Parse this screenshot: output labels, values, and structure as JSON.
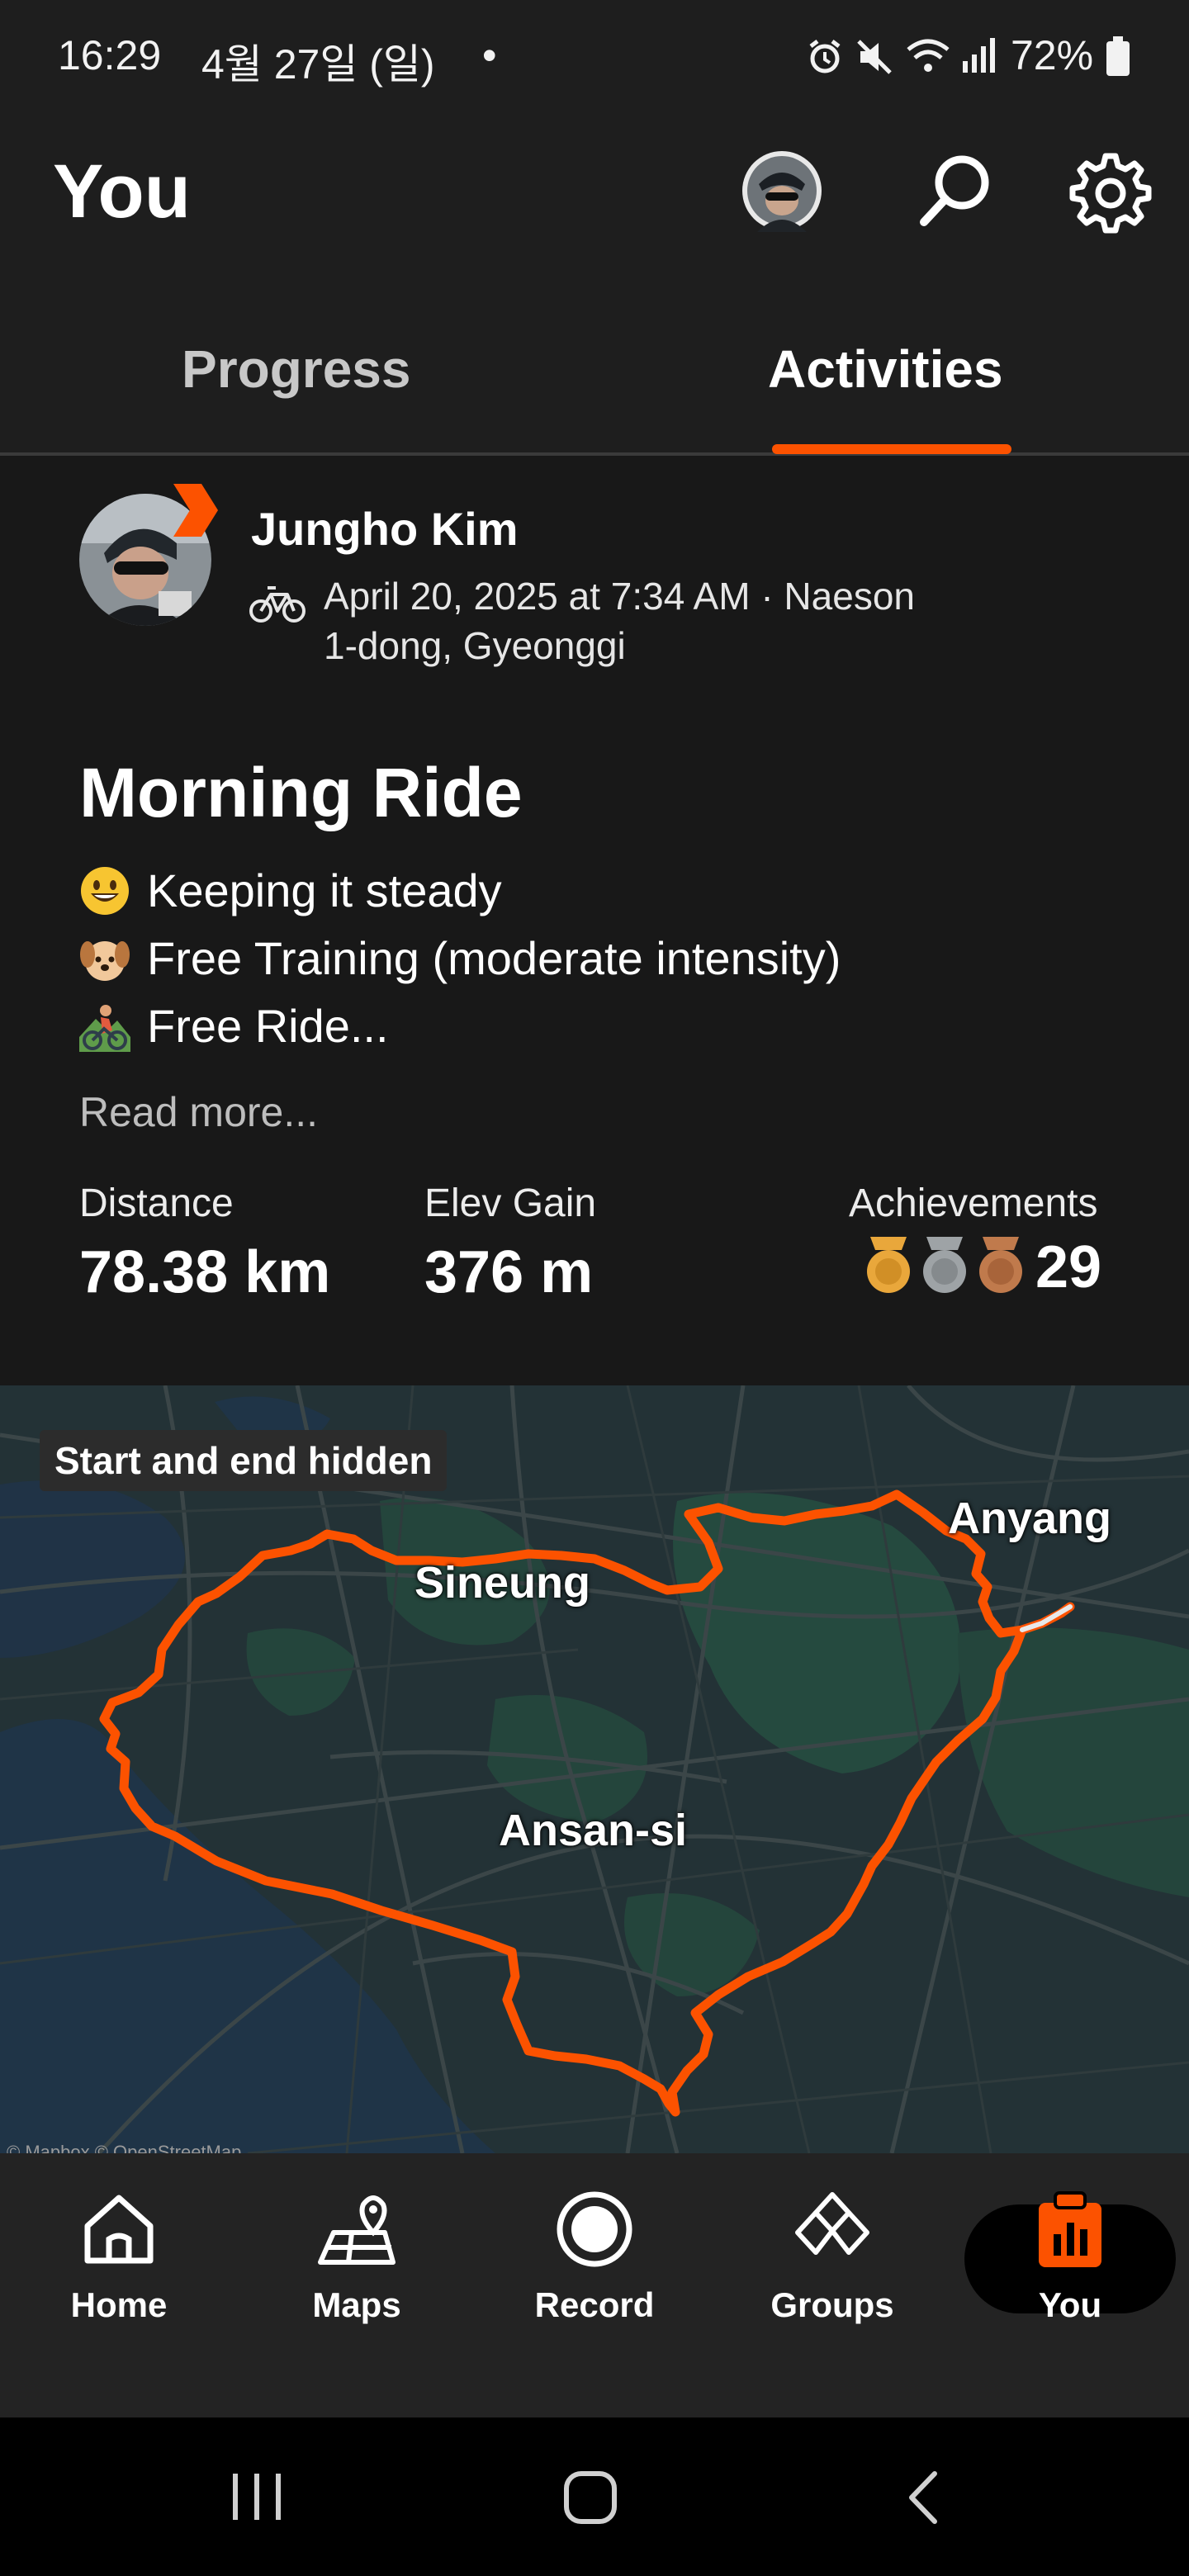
{
  "status_bar": {
    "time": "16:29",
    "date": "4월 27일 (일)",
    "dot": "•",
    "battery": "72%",
    "icons": [
      "alarm-icon",
      "mute-icon",
      "wifi-icon",
      "signal-icon",
      "battery-icon"
    ]
  },
  "header": {
    "title": "You",
    "icons": [
      "avatar",
      "search-icon",
      "gear-icon"
    ]
  },
  "tabs": [
    {
      "label": "Progress",
      "active": false
    },
    {
      "label": "Activities",
      "active": true
    }
  ],
  "activity": {
    "athlete": "Jungho Kim",
    "meta_line1": "April 20, 2025 at 7:34 AM · Naeson",
    "meta_line2": "1-dong, Gyeonggi",
    "title": "Morning Ride",
    "description": [
      {
        "icon": "smiley-emoji",
        "text": "Keeping it steady"
      },
      {
        "icon": "dog-emoji",
        "text": "Free Training (moderate intensity)"
      },
      {
        "icon": "cyclist-emoji",
        "text": "Free Ride..."
      }
    ],
    "read_more": "Read more...",
    "stats": {
      "distance_label": "Distance",
      "distance_value": "78.38 km",
      "elev_label": "Elev Gain",
      "elev_value": "376 m",
      "achievements_label": "Achievements",
      "achievements_count": "29"
    }
  },
  "map": {
    "chip": "Start and end hidden",
    "labels": [
      "Anyang",
      "Sineung",
      "Ansan-si"
    ],
    "attribution": "© Mapbox © OpenStreetMap",
    "route_color": "#fc5200"
  },
  "bottom_nav": [
    {
      "label": "Home",
      "icon": "home-icon"
    },
    {
      "label": "Maps",
      "icon": "maps-icon"
    },
    {
      "label": "Record",
      "icon": "record-icon"
    },
    {
      "label": "Groups",
      "icon": "groups-icon"
    },
    {
      "label": "You",
      "icon": "you-icon",
      "active": true
    }
  ],
  "colors": {
    "accent": "#fc5200",
    "background": "#1e1e1e",
    "card": "#181818",
    "gold": "#e9a73b",
    "silver": "#9ea3a6",
    "bronze": "#c07a4c"
  }
}
